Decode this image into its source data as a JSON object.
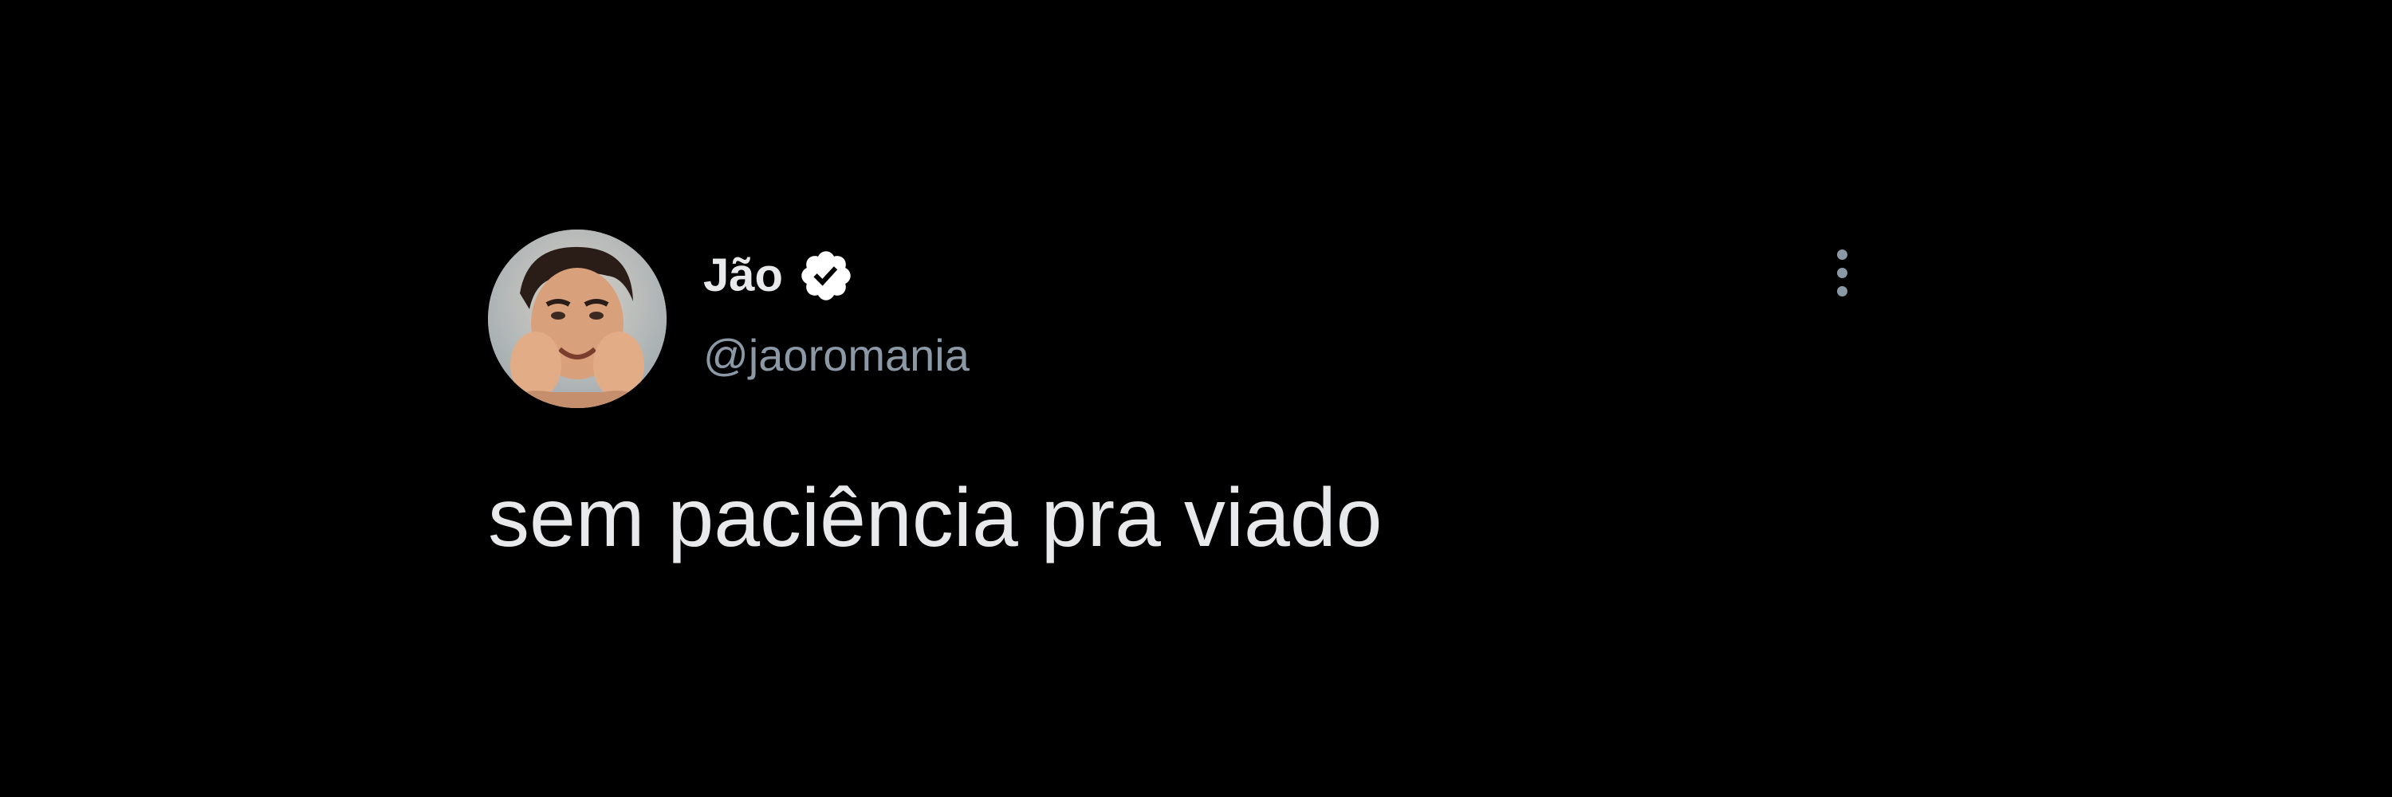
{
  "tweet": {
    "author": {
      "display_name": "Jão",
      "handle": "@jaoromania",
      "verified": true,
      "avatar_icon": "profile-photo"
    },
    "text": "sem paciência pra viado",
    "more_icon": "vertical-ellipsis-icon"
  },
  "colors": {
    "background": "#000000",
    "primary_text": "#e7e9ea",
    "secondary_text": "#8b98a5",
    "verified_badge": "#ffffff"
  }
}
